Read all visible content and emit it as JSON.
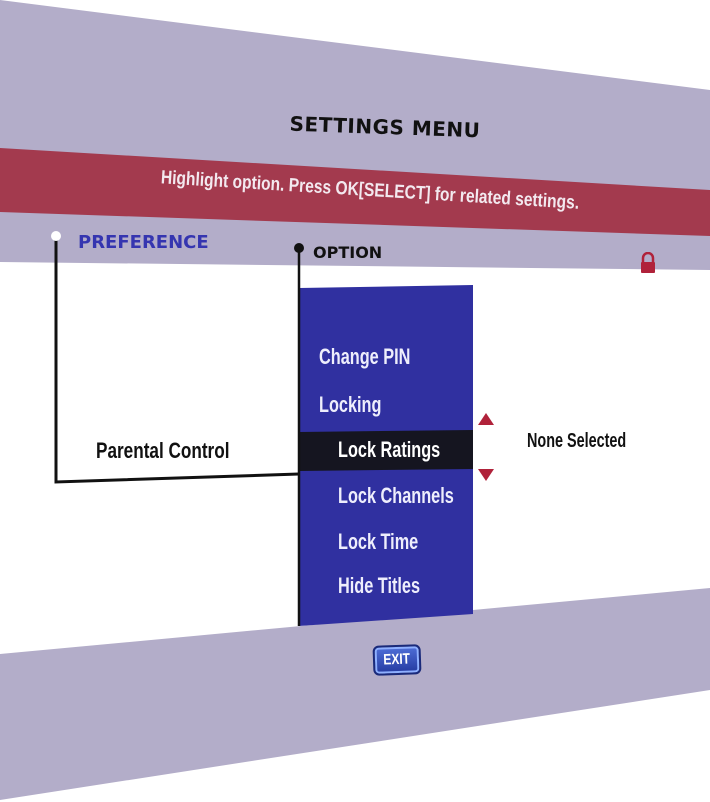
{
  "menu": {
    "title": "SETTINGS MENU",
    "hint": "Highlight option. Press OK[SELECT] for related settings."
  },
  "columns": {
    "preference_header": "PREFERENCE",
    "option_header": "OPTION"
  },
  "preference": {
    "selected_item": "Parental Control"
  },
  "options": {
    "items": [
      {
        "label": "Change PIN",
        "selected": false
      },
      {
        "label": "Locking",
        "selected": false
      },
      {
        "label": "Lock Ratings",
        "selected": true
      },
      {
        "label": "Lock Channels",
        "selected": false
      },
      {
        "label": "Lock Time",
        "selected": false
      },
      {
        "label": "Hide Titles",
        "selected": false
      }
    ]
  },
  "setting_value": "None Selected",
  "buttons": {
    "exit_label": "EXIT"
  },
  "icons": {
    "lock": "lock-icon",
    "scroll_up": "arrow-up-icon",
    "scroll_down": "arrow-down-icon"
  },
  "colors": {
    "panel": "#b3adc9",
    "hint_bar": "#a33a4e",
    "option_column": "#3030a0",
    "selected_row": "#151520",
    "content_area": "#ffffff",
    "accent_red": "#b0223a"
  }
}
